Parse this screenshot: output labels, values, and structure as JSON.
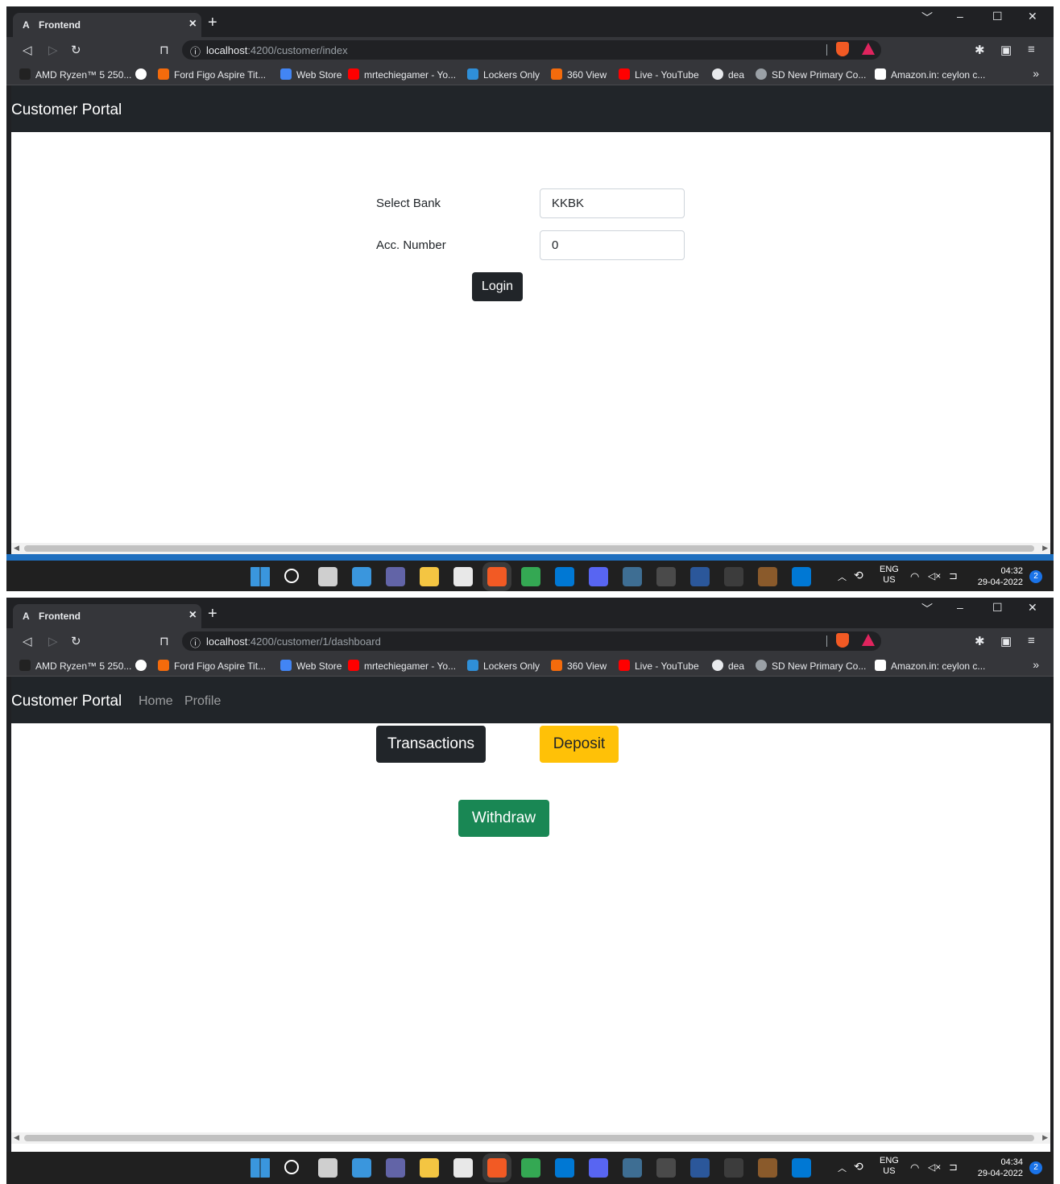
{
  "browser": {
    "tab_title": "Frontend",
    "tab_favicon": "A",
    "tab_close": "×",
    "new_tab": "+",
    "window_controls": {
      "search_tabs": "﹀",
      "minimize": "–",
      "maximize": "☐",
      "close": "✕"
    },
    "bookmarks": [
      {
        "label": "AMD Ryzen™ 5 250...",
        "icon": "amd-icon",
        "color": "#222222"
      },
      {
        "label": "",
        "icon": "google-icon",
        "color": "#ffffff"
      },
      {
        "label": "Ford Figo Aspire Tit...",
        "icon": "bookmark-favicon",
        "color": "#f46b0c"
      },
      {
        "label": "Web Store",
        "icon": "web-store-icon",
        "color": "#4285f4"
      },
      {
        "label": "mrtechiegamer - Yo...",
        "icon": "youtube-icon",
        "color": "#ff0000"
      },
      {
        "label": "Lockers Only",
        "icon": "lockers-icon",
        "color": "#2f8fd8"
      },
      {
        "label": "360 View",
        "icon": "bookmark-favicon",
        "color": "#f46b0c"
      },
      {
        "label": "Live - YouTube",
        "icon": "youtube-icon",
        "color": "#ff0000"
      },
      {
        "label": "dea",
        "icon": "github-icon",
        "color": "#e8eaed"
      },
      {
        "label": "SD New Primary Co...",
        "icon": "globe-icon",
        "color": "#9aa0a6"
      },
      {
        "label": "Amazon.in: ceylon c...",
        "icon": "amazon-icon",
        "color": "#ffffff"
      }
    ],
    "more_bookmarks": "»"
  },
  "login_screen": {
    "url_host": "localhost",
    "url_path": ":4200/customer/index",
    "navbar_brand": "Customer Portal",
    "form": {
      "bank_label": "Select Bank",
      "bank_value": "KKBK",
      "account_label": "Acc. Number",
      "account_value": "0",
      "login_button": "Login"
    },
    "clock_time": "04:32",
    "clock_date": "29-04-2022"
  },
  "dashboard_screen": {
    "url_host": "localhost",
    "url_path": ":4200/customer/1/dashboard",
    "navbar_brand": "Customer Portal",
    "nav_links": [
      "Home",
      "Profile"
    ],
    "buttons": {
      "transactions": "Transactions",
      "deposit": "Deposit",
      "withdraw": "Withdraw"
    },
    "clock_time": "04:34",
    "clock_date": "29-04-2022"
  },
  "taskbar": {
    "apps": [
      {
        "name": "windows-start-icon",
        "color": "#3a96dd"
      },
      {
        "name": "search-icon",
        "color": ""
      },
      {
        "name": "task-view-icon",
        "color": "#cfcfcf"
      },
      {
        "name": "widgets-icon",
        "color": "#3a96dd"
      },
      {
        "name": "teams-chat-icon",
        "color": "#6264a7"
      },
      {
        "name": "file-explorer-icon",
        "color": "#f4c542"
      },
      {
        "name": "microsoft-store-icon",
        "color": "#e8e8e8"
      },
      {
        "name": "brave-icon",
        "color": "#f25a24"
      },
      {
        "name": "chrome-icon",
        "color": "#34a853"
      },
      {
        "name": "mail-icon",
        "color": "#0078d4"
      },
      {
        "name": "discord-icon",
        "color": "#5865f2"
      },
      {
        "name": "mysql-workbench-icon",
        "color": "#3e6e93"
      },
      {
        "name": "mysql-shell-icon",
        "color": "#4a4a4a"
      },
      {
        "name": "word-icon",
        "color": "#2b579a"
      },
      {
        "name": "terminal-icon",
        "color": "#3c3c3c"
      },
      {
        "name": "game-icon",
        "color": "#8a5a2b"
      },
      {
        "name": "vscode-icon",
        "color": "#0078d4"
      }
    ],
    "lang_top": "ENG",
    "lang_bottom": "US",
    "notification_count": "2"
  }
}
